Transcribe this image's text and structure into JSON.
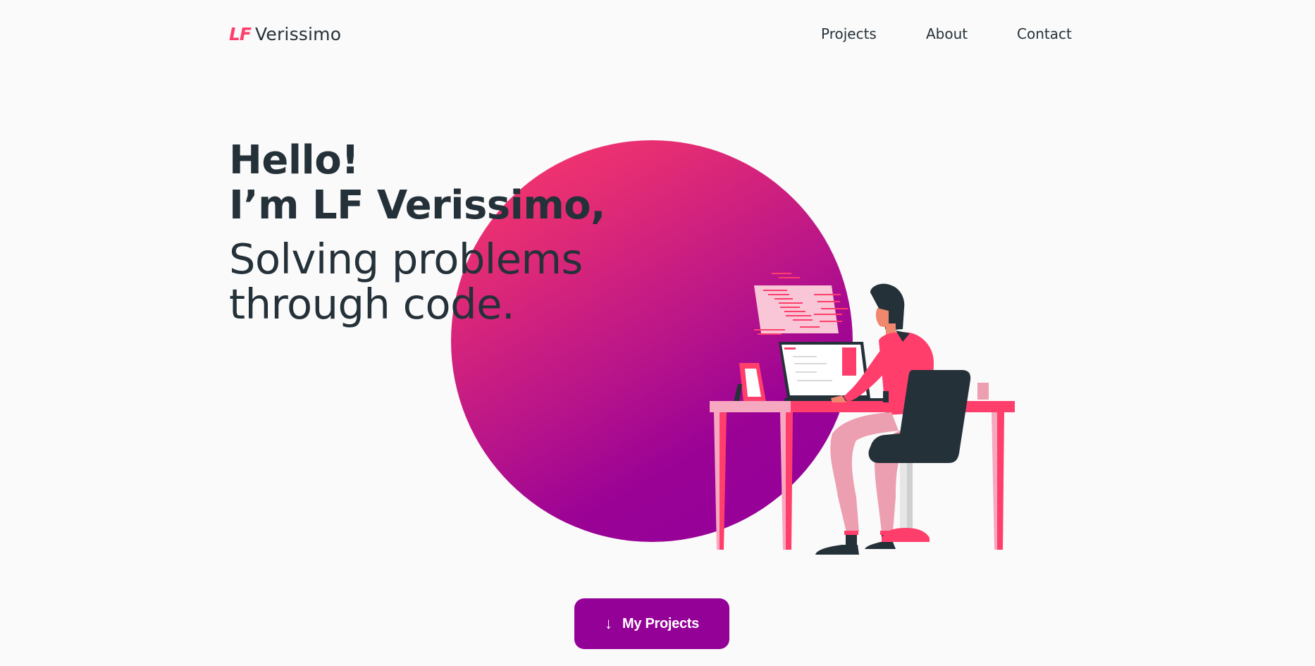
{
  "header": {
    "logo_mark": "LF",
    "logo_text": "Verissimo",
    "nav": [
      {
        "label": "Projects"
      },
      {
        "label": "About"
      },
      {
        "label": "Contact"
      }
    ]
  },
  "hero": {
    "greeting_line1": "Hello!",
    "greeting_line2": "I’m LF Verissimo,",
    "tagline_line1": "Solving problems",
    "tagline_line2": "through code."
  },
  "cta": {
    "icon": "arrow-down-icon",
    "label": "My Projects"
  },
  "colors": {
    "accent": "#ff3e6c",
    "brand": "#940196",
    "text": "#253139",
    "background": "#fafafa"
  }
}
